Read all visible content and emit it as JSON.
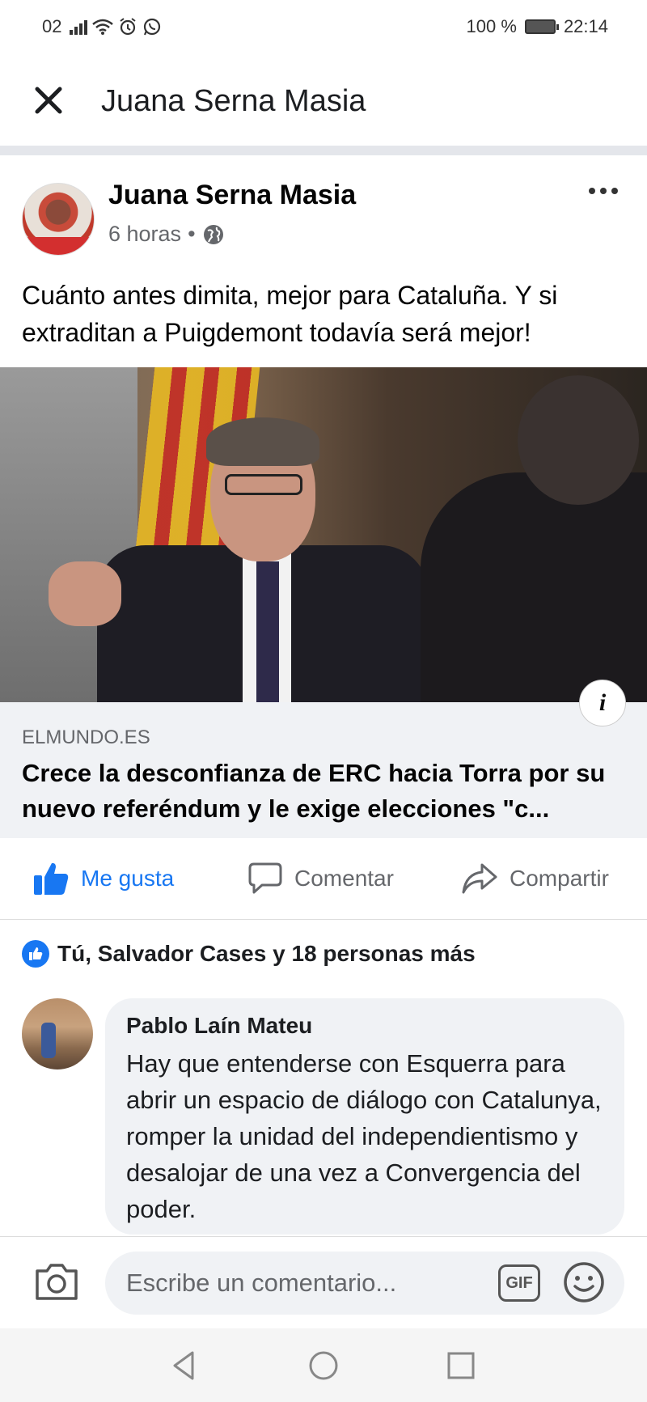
{
  "status_bar": {
    "carrier": "02",
    "battery_text": "100 %",
    "time": "22:14",
    "icons": [
      "signal-icon",
      "wifi-icon",
      "alarm-icon",
      "whatsapp-icon",
      "battery-icon"
    ]
  },
  "header": {
    "title": "Juana Serna Masia",
    "close_icon": "close-icon"
  },
  "post": {
    "author": "Juana Serna Masia",
    "time": "6 horas",
    "separator": "•",
    "privacy_icon": "globe-icon",
    "text": "Cuánto antes dimita, mejor para Cataluña. Y si extraditan a Puigdemont todavía será mejor!",
    "link": {
      "domain": "ELMUNDO.ES",
      "title": "Crece la desconfianza de ERC hacia Torra por su nuevo referéndum y le exige elecciones \"c...",
      "info_label": "i"
    }
  },
  "actions": {
    "like": "Me gusta",
    "comment": "Comentar",
    "share": "Compartir"
  },
  "reactions": {
    "summary": "Tú, Salvador Cases y 18 personas más"
  },
  "comment": {
    "author": "Pablo Laín Mateu",
    "text": "Hay que entenderse con Esquerra para abrir un espacio de diálogo con Catalunya, romper la unidad del independientismo y desalojar de una vez a Convergencia del poder."
  },
  "composer": {
    "placeholder": "Escribe un comentario...",
    "gif_label": "GIF"
  },
  "colors": {
    "accent": "#1877f2",
    "secondary_text": "#65676b",
    "bubble_bg": "#f0f2f5"
  }
}
